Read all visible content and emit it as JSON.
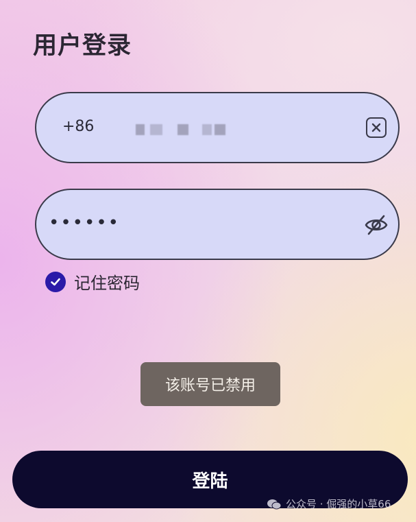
{
  "page": {
    "title": "用户登录"
  },
  "phone": {
    "country_code": "+86"
  },
  "password": {
    "masked_value": "••••••"
  },
  "remember": {
    "label": "记住密码",
    "checked": true
  },
  "toast": {
    "message": "该账号已禁用"
  },
  "login": {
    "label": "登陆"
  },
  "watermark": {
    "text": "公众号 · 倔强的小草66"
  },
  "colors": {
    "field_background": "#d7d9f8",
    "checkbox_accent": "#2b1aa8",
    "login_button": "#0d0a2e",
    "toast_background": "#6e6560"
  },
  "icons": {
    "clear": "close-box-icon",
    "visibility": "eye-off-icon",
    "check": "check-icon",
    "watermark": "wechat-icon"
  }
}
